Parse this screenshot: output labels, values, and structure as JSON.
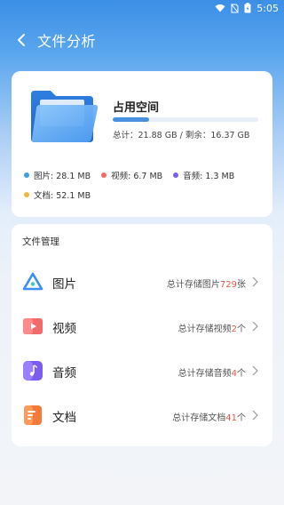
{
  "status_bar": {
    "time": "5:05",
    "icons": [
      "wifi-icon",
      "no-sim-icon",
      "battery-icon"
    ]
  },
  "header": {
    "title": "文件分析",
    "back_icon": "back-arrow-icon"
  },
  "storage": {
    "title": "占用空间",
    "summary": "总计：21.88 GB / 剩余：16.37 GB",
    "used_fraction": 0.25,
    "legend": [
      {
        "label": "图片: 28.1 MB",
        "color": "#3aa0e8"
      },
      {
        "label": "视频: 6.7 MB",
        "color": "#f06a6a"
      },
      {
        "label": "音频: 1.3 MB",
        "color": "#7a5cf0"
      },
      {
        "label": "文档: 52.1 MB",
        "color": "#f5b63c"
      }
    ]
  },
  "files": {
    "section_title": "文件管理",
    "items": [
      {
        "label": "图片",
        "count_prefix": "总计存储图片",
        "count": "729",
        "count_suffix": "张",
        "icon": "image-triangle-icon"
      },
      {
        "label": "视频",
        "count_prefix": "总计存储视频",
        "count": "2",
        "count_suffix": "个",
        "icon": "video-play-icon"
      },
      {
        "label": "音频",
        "count_prefix": "总计存储音频",
        "count": "4",
        "count_suffix": "个",
        "icon": "music-note-icon"
      },
      {
        "label": "文档",
        "count_prefix": "总计存储文档",
        "count": "41",
        "count_suffix": "个",
        "icon": "document-icon"
      }
    ]
  },
  "colors": {
    "accent": "#3b8fe6",
    "count_highlight": "#e25b4a"
  }
}
